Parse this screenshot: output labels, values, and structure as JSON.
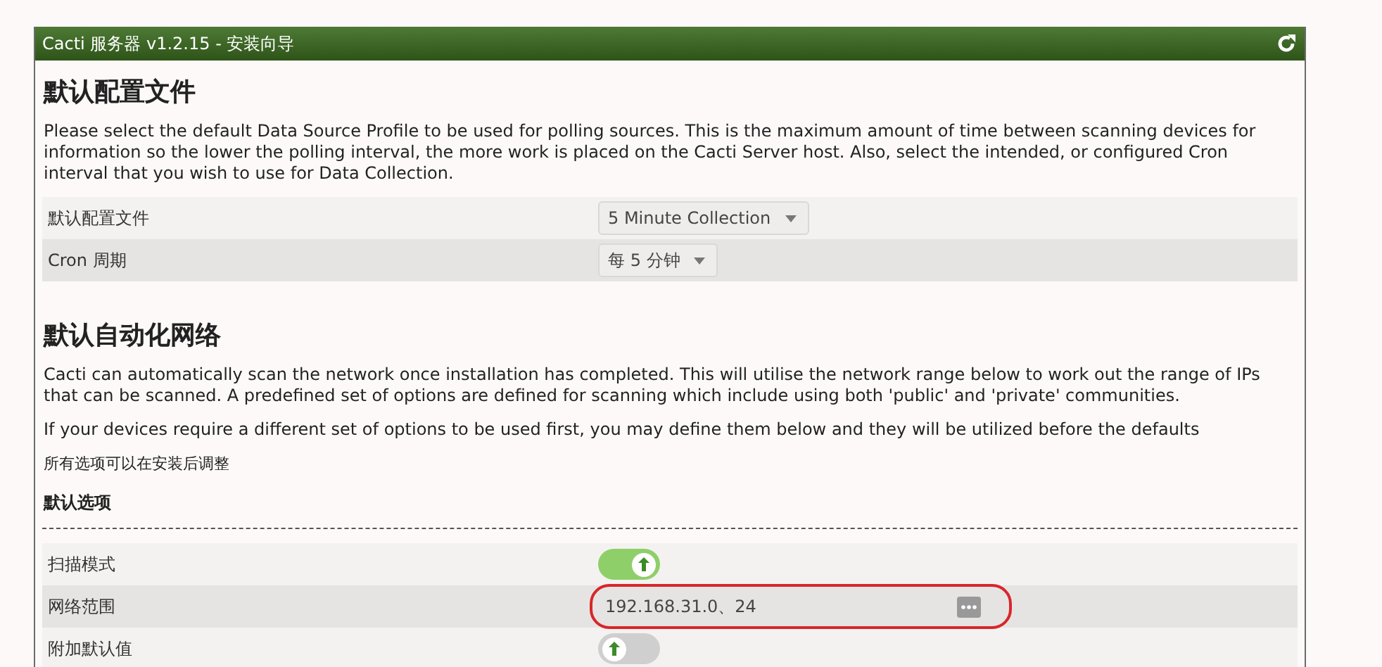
{
  "window": {
    "title": "Cacti 服务器 v1.2.15 - 安装向导"
  },
  "sections": [
    {
      "heading": "默认配置文件",
      "paragraphs": [
        "Please select the default Data Source Profile to be used for polling sources. This is the maximum amount of time between scanning devices for information so the lower the polling interval, the more work is placed on the Cacti Server host. Also, select the intended, or configured Cron interval that you wish to use for Data Collection."
      ],
      "rows": [
        {
          "kind": "dropdown",
          "label": "默认配置文件",
          "value": "5 Minute Collection"
        },
        {
          "kind": "dropdown",
          "label": "Cron 周期",
          "value": "每 5 分钟"
        }
      ]
    },
    {
      "heading": "默认自动化网络",
      "paragraphs": [
        "Cacti can automatically scan the network once installation has completed. This will utilise the network range below to work out the range of IPs that can be scanned. A predefined set of options are defined for scanning which include using both 'public' and 'private' communities.",
        "If your devices require a different set of options to be used first, you may define them below and they will be utilized before the defaults"
      ],
      "note": "所有选项可以在安装后调整",
      "subheading": "默认选项",
      "rows": [
        {
          "kind": "toggle",
          "label": "扫描模式",
          "on": true
        },
        {
          "kind": "text",
          "label": "网络范围",
          "value": "192.168.31.0、24",
          "highlighted": true
        },
        {
          "kind": "toggle",
          "label": "附加默认值",
          "on": false
        }
      ]
    }
  ]
}
